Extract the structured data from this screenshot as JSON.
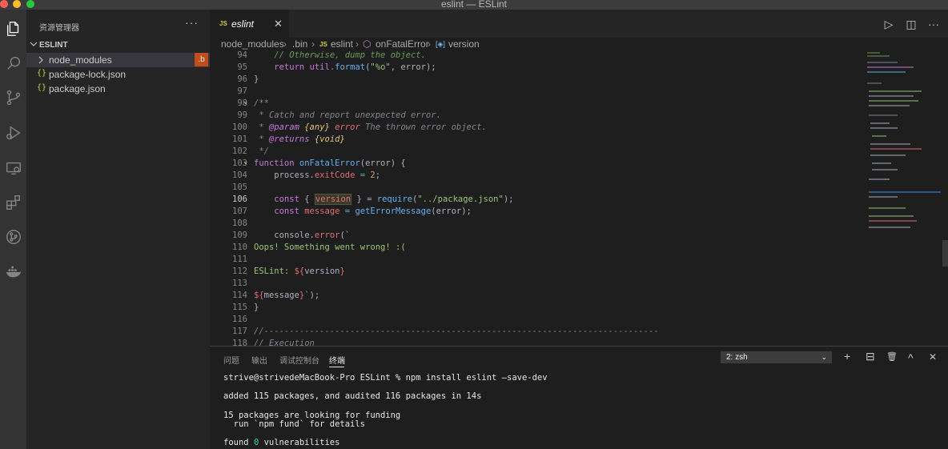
{
  "window": {
    "title": "eslint — ESLint"
  },
  "colors": {
    "close": "#ff5f57",
    "minimize": "#febc2e",
    "zoom": "#28c840",
    "badge": "#c24b1a"
  },
  "activity": [
    "explorer-icon",
    "search-icon",
    "source-control-icon",
    "run-debug-icon",
    "remote-explorer-icon",
    "extensions-icon",
    "git-graph-icon",
    "docker-icon"
  ],
  "sidebar": {
    "title": "资源管理器",
    "more": "···",
    "section": "ESLINT",
    "items": [
      {
        "label": "node_modules",
        "badge": ".b"
      },
      {
        "label": "package-lock.json",
        "icon": "{}"
      },
      {
        "label": "package.json",
        "icon": "{}"
      }
    ]
  },
  "tab": {
    "icon": "JS",
    "label": "eslint",
    "close": "✕"
  },
  "breadcrumb": {
    "p1": "node_modules",
    "p2": ".bin",
    "p3": "eslint",
    "p4": "onFatalError",
    "p5": "version",
    "js": "JS"
  },
  "code": {
    "lines": [
      "94",
      "95",
      "96",
      "97",
      "98",
      "99",
      "100",
      "101",
      "102",
      "103",
      "104",
      "105",
      "106",
      "107",
      "108",
      "109",
      "110",
      "111",
      "112",
      "113",
      "114",
      "115",
      "116",
      "117",
      "118"
    ],
    "l94": "    // Otherwise, dump the object.",
    "l95_a": "    return util.",
    "l95_b": "format",
    "l95_c": "(",
    "l95_d": "\"%o\"",
    "l95_e": ", error);",
    "l96": "}",
    "l98": "/**",
    "l99": " * Catch and report unexpected error.",
    "l100_a": " * ",
    "l100_b": "@param",
    "l100_c": " {any}",
    "l100_d": " error",
    "l100_e": " The thrown error object.",
    "l101_a": " * ",
    "l101_b": "@returns",
    "l101_c": " {void}",
    "l102": " */",
    "l103_a": "function ",
    "l103_b": "onFatalError",
    "l103_c": "(error) {",
    "l104_a": "    process.",
    "l104_b": "exitCode",
    "l104_c": " = ",
    "l104_d": "2",
    "l104_e": ";",
    "l106_a": "    const",
    "l106_b": " { ",
    "l106_c": "version",
    "l106_d": " } = ",
    "l106_e": "require",
    "l106_f": "(",
    "l106_g": "\"../package.json\"",
    "l106_h": ");",
    "l107_a": "    const ",
    "l107_b": "message",
    "l107_c": " = ",
    "l107_d": "getErrorMessage",
    "l107_e": "(error);",
    "l109_a": "    console.",
    "l109_b": "error",
    "l109_c": "(",
    "l109_d": "`",
    "l110": "Oops! Something went wrong! :(",
    "l112_a": "ESLint: ",
    "l112_b": "${",
    "l112_c": "version",
    "l112_d": "}",
    "l114_a": "${",
    "l114_b": "message",
    "l114_c": "}",
    "l114_d": "`",
    "l114_e": ");",
    "l115": "}",
    "l117": "//------------------------------------------------------------------------------",
    "l118": "// Execution"
  },
  "panel": {
    "tabs": [
      "问题",
      "输出",
      "调试控制台",
      "终端"
    ],
    "terminal_select": "2: zsh",
    "actions": [
      "+",
      "⊟",
      "🗑",
      "^",
      "✕"
    ],
    "term": {
      "l1": "strive@strivedeMacBook-Pro ESLint % npm install eslint —save-dev",
      "l2": "added 115 packages, and audited 116 packages in 14s",
      "l3": "15 packages are looking for funding",
      "l4": "  run `npm fund` for details",
      "l5a": "found ",
      "l5b": "0",
      "l5c": " vulnerabilities"
    }
  }
}
